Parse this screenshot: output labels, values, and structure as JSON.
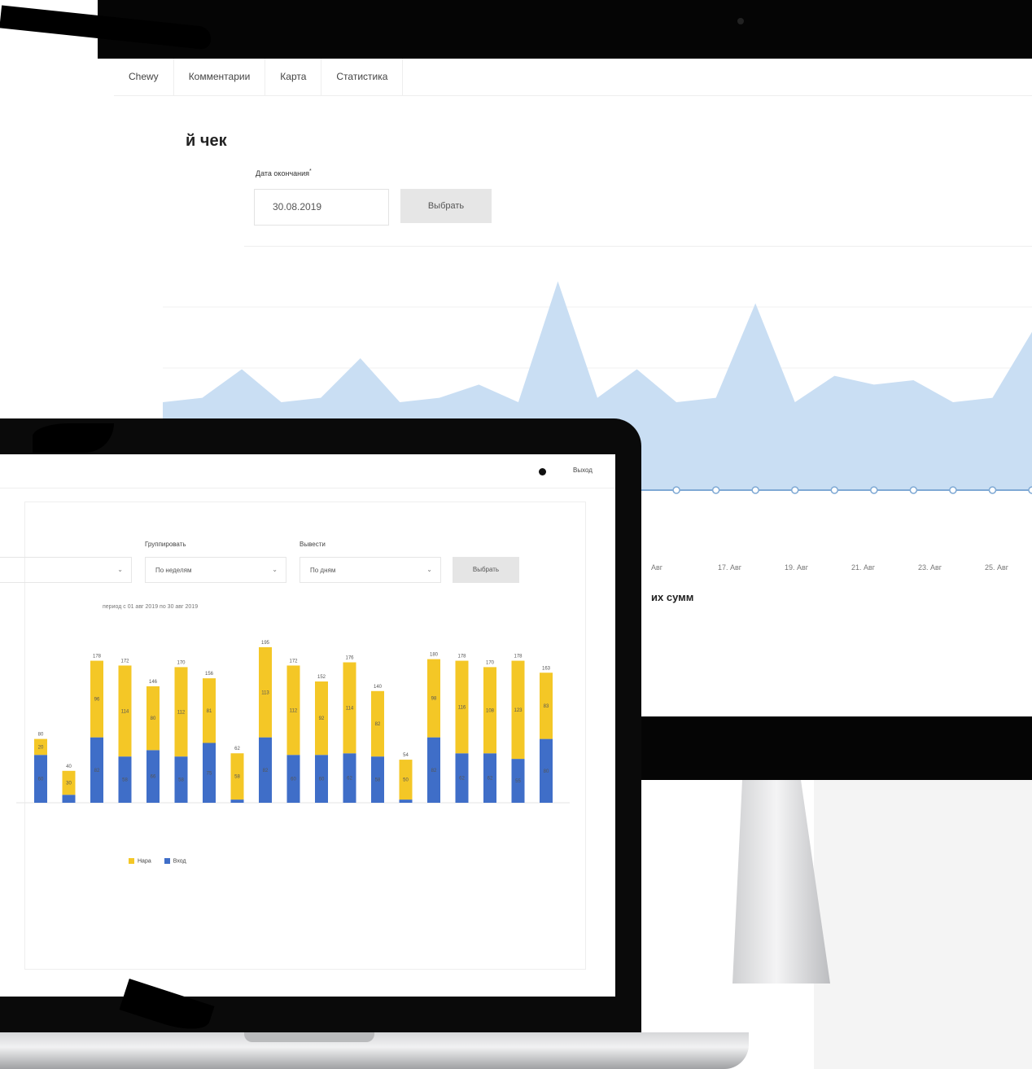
{
  "monitor": {
    "tabs": [
      "Chewy",
      "Комментарии",
      "Карта",
      "Статистика"
    ],
    "section_title": "й чек",
    "date_label": "Дата окончания",
    "date_value": "30.08.2019",
    "select_button": "Выбрать",
    "subheading": "их сумм",
    "colors": {
      "area_fill": "#c9def3",
      "line": "#7fa9d4"
    }
  },
  "monitor_chart": {
    "type": "area",
    "x_ticks": [
      "Авг",
      "17. Авг",
      "19. Авг",
      "21. Авг",
      "23. Авг",
      "25. Авг"
    ],
    "values": [
      40,
      42,
      55,
      40,
      42,
      60,
      40,
      42,
      48,
      40,
      95,
      42,
      55,
      40,
      42,
      85,
      40,
      52,
      48,
      50,
      40,
      42,
      72
    ]
  },
  "laptop": {
    "exit_label": "Выход",
    "grouping_label": "Группировать",
    "grouping_value": "По неделям",
    "display_label": "Вывести",
    "display_value": "По дням",
    "first_select_value": "",
    "select_button": "Выбрать",
    "period_text": "период с 01 авг 2019 по 30 авг 2019",
    "legend": [
      {
        "name": "Нара",
        "color": "#f4c726"
      },
      {
        "name": "Вход",
        "color": "#3f6ec8"
      }
    ]
  },
  "chart_data": {
    "type": "bar",
    "stacked": true,
    "series": [
      {
        "name": "Вход",
        "color": "#3f6ec8",
        "values": [
          60,
          10,
          82,
          58,
          66,
          58,
          75,
          4,
          82,
          60,
          60,
          62,
          58,
          4,
          82,
          62,
          62,
          55,
          80
        ]
      },
      {
        "name": "Нара",
        "color": "#f4c726",
        "values": [
          20,
          30,
          96,
          114,
          80,
          112,
          81,
          58,
          113,
          112,
          92,
          114,
          82,
          50,
          98,
          116,
          108,
          123,
          83
        ]
      }
    ],
    "totals": [
      80,
      40,
      178,
      172,
      146,
      170,
      156,
      62,
      195,
      172,
      152,
      176,
      140,
      54,
      180,
      178,
      170,
      178,
      163
    ]
  }
}
